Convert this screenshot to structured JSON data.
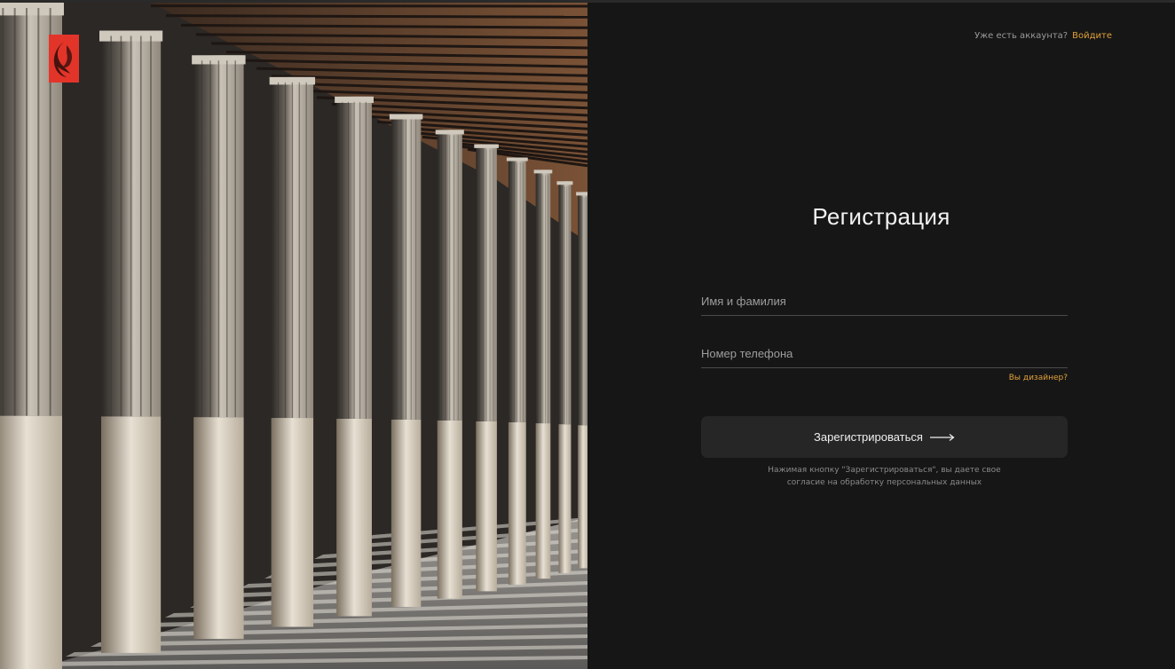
{
  "header": {
    "login_prompt": "Уже есть аккаунта?",
    "login_link": "Войдите"
  },
  "brand": {
    "logo_icon": "phoenix-logo-icon",
    "logo_color": "#e3342a"
  },
  "form": {
    "title": "Регистрация",
    "name_placeholder": "Имя и фамилия",
    "phone_placeholder": "Номер телефона",
    "designer_link": "Вы дизайнер?",
    "submit_label": "Зарегистрироваться",
    "submit_icon": "arrow-right-icon",
    "consent_line1": "Нажимая кнопку \"Зарегистрироваться\", вы даете свое",
    "consent_line2": "согласие на обработку персональных данных"
  },
  "colors": {
    "background": "#161616",
    "accent": "#e2a13a",
    "button": "#262626"
  }
}
